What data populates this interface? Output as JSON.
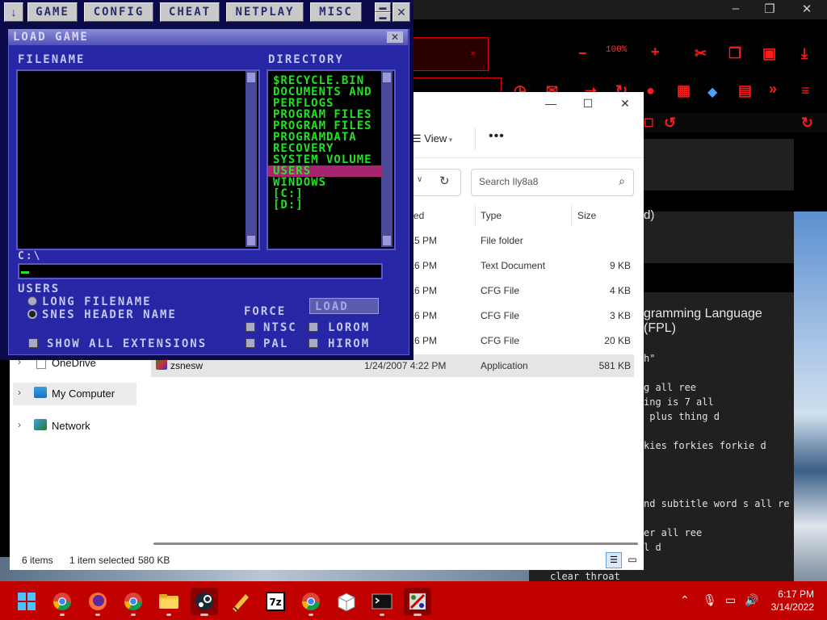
{
  "browser": {
    "zoom": "100%",
    "tab_close": "×",
    "minimize": "–",
    "maximize": "❐",
    "close": "✕",
    "card2_text": "d)",
    "article_title": "gramming Language\n(FPL)",
    "code_lines": [
      "h\"",
      "g all ree",
      "ing is 7 all",
      " plus thing d",
      "kies forkies forkie d",
      "nd subtitle word s all re",
      "er all ree",
      "l d",
      "clear throat"
    ]
  },
  "explorer": {
    "minimize": "—",
    "maximize": "☐",
    "close": "✕",
    "view_label": "View",
    "more_label": "•••",
    "search_placeholder": "Search Ily8a8",
    "columns": {
      "date": "ed",
      "type": "Type",
      "size": "Size"
    },
    "files": [
      {
        "name": "",
        "date": ":15 PM",
        "type": "File folder",
        "size": ""
      },
      {
        "name": "",
        "date": ":16 PM",
        "type": "Text Document",
        "size": "9 KB"
      },
      {
        "name": "",
        "date": ":16 PM",
        "type": "CFG File",
        "size": "4 KB"
      },
      {
        "name": "",
        "date": ":16 PM",
        "type": "CFG File",
        "size": "3 KB"
      },
      {
        "name": "",
        "date": ":16 PM",
        "type": "CFG File",
        "size": "20 KB"
      },
      {
        "name": "zsnesw",
        "date": "1/24/2007 4:22 PM",
        "type": "Application",
        "size": "581 KB"
      }
    ],
    "nav": {
      "onedrive": "OneDrive",
      "my_computer": "My Computer",
      "network": "Network"
    },
    "status": {
      "items": "6 items",
      "selected": "1 item selected",
      "size": "580 KB"
    }
  },
  "zsnes": {
    "menus": [
      "GAME",
      "CONFIG",
      "CHEAT",
      "NETPLAY",
      "MISC"
    ],
    "dialog_title": "LOAD GAME",
    "filename_label": "FILENAME",
    "directory_label": "DIRECTORY",
    "directories": [
      "$RECYCLE.BIN",
      "DOCUMENTS AND",
      "PERFLOGS",
      "PROGRAM FILES",
      "PROGRAM FILES",
      "PROGRAMDATA",
      "RECOVERY",
      "SYSTEM VOLUME",
      "USERS",
      "WINDOWS",
      "[C:]",
      "[D:]"
    ],
    "selected_directory": "USERS",
    "current_path": "C:\\",
    "selected_dir_label": "USERS",
    "radio_long": "LONG FILENAME",
    "radio_snes": "SNES HEADER NAME",
    "force_label": "FORCE",
    "load_button": "LOAD",
    "show_all": "SHOW ALL EXTENSIONS",
    "ntsc": "NTSC",
    "pal": "PAL",
    "lorom": "LOROM",
    "hirom": "HIROM"
  },
  "taskbar": {
    "time": "6:17 PM",
    "date": "3/14/2022",
    "apps": [
      "windows-start",
      "chrome",
      "firefox",
      "chrome",
      "file-explorer",
      "steam",
      "app-yellow",
      "7zip",
      "chrome",
      "package",
      "terminal",
      "zsnes"
    ]
  }
}
